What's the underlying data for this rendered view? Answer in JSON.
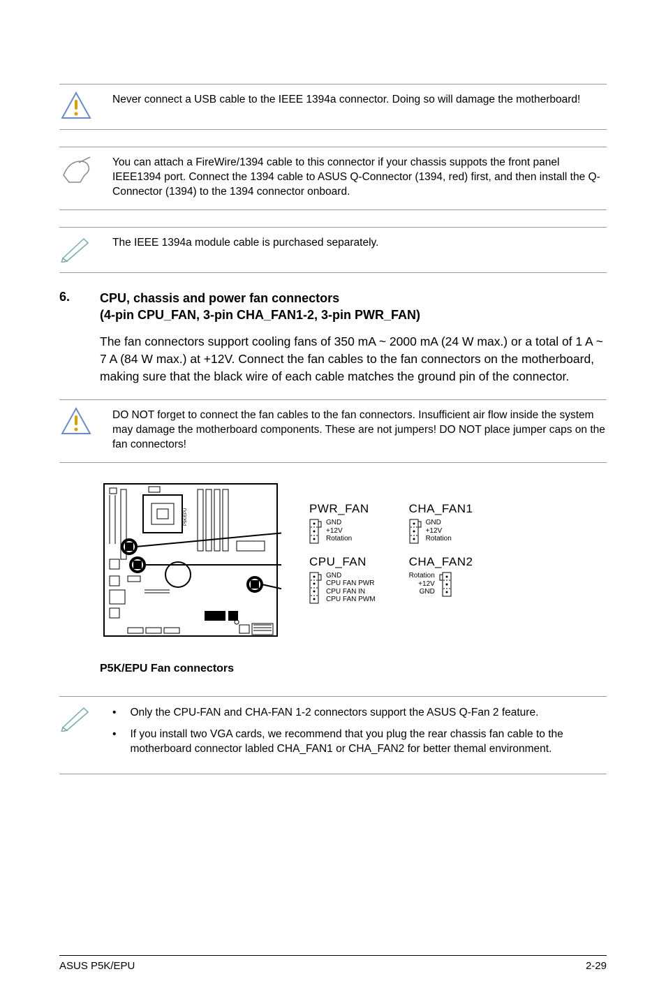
{
  "callouts": {
    "c1": "Never connect a USB cable to the IEEE 1394a connector. Doing so will damage the motherboard!",
    "c2": "You can attach a FireWire/1394 cable to this connector if your chassis suppots the front panel IEEE1394 port. Connect the 1394 cable to ASUS Q-Connector (1394, red) first, and then install the Q-Connector (1394) to the 1394 connector onboard.",
    "c3": "The IEEE 1394a module cable is purchased separately.",
    "c4": "DO NOT forget to connect the fan cables to the fan connectors. Insufficient air flow inside the system may damage the motherboard components. These are not jumpers! DO NOT place jumper caps on the fan connectors!"
  },
  "section": {
    "num": "6.",
    "title_l1": "CPU, chassis and power fan connectors",
    "title_l2": "(4-pin CPU_FAN, 3-pin CHA_FAN1-2, 3-pin PWR_FAN)",
    "body": "The fan connectors support cooling fans of 350 mA ~ 2000 mA (24 W max.) or a total of 1 A ~ 7 A (84 W max.) at +12V. Connect the fan cables to the fan connectors on the motherboard, making sure that the black wire of each cable matches the ground pin of the connector."
  },
  "diagram": {
    "board_label": "P5K/EPU",
    "caption": "P5K/EPU Fan connectors",
    "fans": {
      "pwr_fan": {
        "title": "PWR_FAN",
        "pins": [
          "GND",
          "+12V",
          "Rotation"
        ],
        "align": "right"
      },
      "cha_fan1": {
        "title": "CHA_FAN1",
        "pins": [
          "GND",
          "+12V",
          "Rotation"
        ],
        "align": "right"
      },
      "cpu_fan": {
        "title": "CPU_FAN",
        "pins": [
          "GND",
          "CPU FAN PWR",
          "CPU FAN IN",
          "CPU FAN PWM"
        ],
        "align": "right"
      },
      "cha_fan2": {
        "title": "CHA_FAN2",
        "pins": [
          "Rotation",
          "+12V",
          "GND"
        ],
        "align": "left"
      }
    }
  },
  "notes": {
    "n1": "Only the CPU-FAN and CHA-FAN 1-2 connectors support the ASUS Q-Fan 2 feature.",
    "n2": "If you install two VGA cards, we recommend that you plug the rear chassis fan cable to the motherboard connector labled CHA_FAN1 or CHA_FAN2 for better themal environment."
  },
  "footer": {
    "left": "ASUS P5K/EPU",
    "right": "2-29"
  }
}
